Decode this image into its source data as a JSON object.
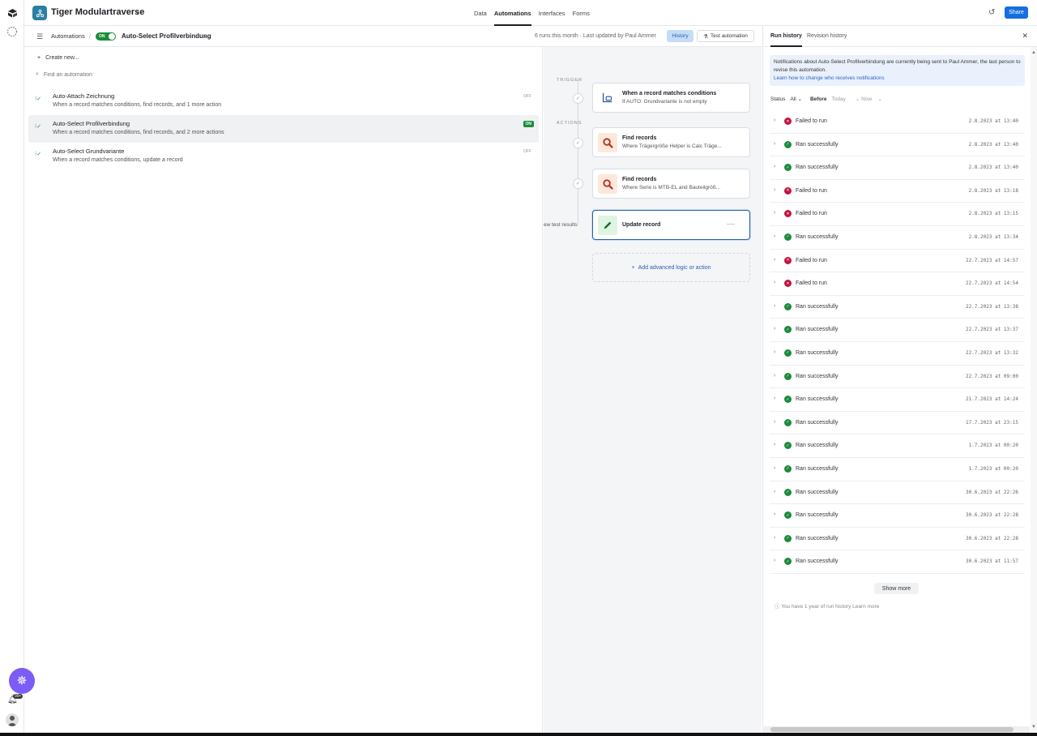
{
  "base": {
    "name": "Tiger Modulartraverse"
  },
  "nav": {
    "items": [
      "Data",
      "Automations",
      "Interfaces",
      "Forms"
    ],
    "active": 1
  },
  "share_label": "Share",
  "subheader": {
    "section": "Automations",
    "separator": "/",
    "toggle_label": "ON",
    "automation_name": "Auto-Select Profilverbindung",
    "meta": "6 runs this month · Last updated by Paul Ammer",
    "history_label": "History",
    "test_label": "Test automation"
  },
  "list": {
    "create_label": "Create new...",
    "find_placeholder": "Find an automation",
    "automations": [
      {
        "title": "Auto-Attach Zeichnung",
        "desc": "When a record matches conditions, find records, and 1 more action",
        "status": "OFF"
      },
      {
        "title": "Auto-Select Profilverbindung",
        "desc": "When a record matches conditions, find records, and 2 more actions",
        "status": "ON"
      },
      {
        "title": "Auto-Select Grundvariante",
        "desc": "When a record matches conditions, update a record",
        "status": "OFF"
      }
    ]
  },
  "canvas": {
    "trigger_label": "TRIGGER",
    "actions_label": "ACTIONS",
    "view_test_results": "ew test results",
    "steps": [
      {
        "title": "When a record matches conditions",
        "desc": "If AUTO: Grundvariante is not empty",
        "icon": "trigger-condition-icon"
      },
      {
        "title": "Find records",
        "desc": "Where Trägergröße Helper is Calc Träge...",
        "icon": "search-icon"
      },
      {
        "title": "Find records",
        "desc": "Where Serie is MTB-EL and Bauteilgröß...",
        "icon": "search-icon"
      },
      {
        "title": "Update record",
        "desc": "",
        "icon": "pencil-icon"
      }
    ],
    "add_logic_label": "Add advanced logic or action"
  },
  "right": {
    "tabs": [
      "Run history",
      "Revision history"
    ],
    "notice_text": "Notifications about Auto-Select Profilverbindung are currently being sent to Paul Ammer, the last person to revise this automation.",
    "notice_link": "Learn how to change who receives notifications",
    "filters": {
      "status_label": "Status",
      "status_value": "All",
      "before_label": "Before",
      "before_value": "Today",
      "now_value": "Now"
    },
    "runs": [
      {
        "status": "fail",
        "label": "Failed to run",
        "time": "2.8.2023 at 13:40"
      },
      {
        "status": "ok",
        "label": "Ran successfully",
        "time": "2.8.2023 at 13:40"
      },
      {
        "status": "ok",
        "label": "Ran successfully",
        "time": "2.8.2023 at 13:40"
      },
      {
        "status": "fail",
        "label": "Failed to run",
        "time": "2.8.2023 at 13:18"
      },
      {
        "status": "fail",
        "label": "Failed to run",
        "time": "2.8.2023 at 13:15"
      },
      {
        "status": "ok",
        "label": "Ran successfully",
        "time": "2.8.2023 at 13:34"
      },
      {
        "status": "fail",
        "label": "Failed to run",
        "time": "22.7.2023 at 14:57"
      },
      {
        "status": "fail",
        "label": "Failed to run",
        "time": "22.7.2023 at 14:54"
      },
      {
        "status": "ok",
        "label": "Ran successfully",
        "time": "22.7.2023 at 13:38"
      },
      {
        "status": "ok",
        "label": "Ran successfully",
        "time": "22.7.2023 at 13:37"
      },
      {
        "status": "ok",
        "label": "Ran successfully",
        "time": "22.7.2023 at 13:32"
      },
      {
        "status": "ok",
        "label": "Ran successfully",
        "time": "22.7.2023 at 09:00"
      },
      {
        "status": "ok",
        "label": "Ran successfully",
        "time": "21.7.2023 at 14:24"
      },
      {
        "status": "ok",
        "label": "Ran successfully",
        "time": "17.7.2023 at 23:15"
      },
      {
        "status": "ok",
        "label": "Ran successfully",
        "time": "1.7.2023 at 00:20"
      },
      {
        "status": "ok",
        "label": "Ran successfully",
        "time": "1.7.2023 at 00:20"
      },
      {
        "status": "ok",
        "label": "Ran successfully",
        "time": "30.6.2023 at 22:26"
      },
      {
        "status": "ok",
        "label": "Ran successfully",
        "time": "30.6.2023 at 22:28"
      },
      {
        "status": "ok",
        "label": "Ran successfully",
        "time": "30.6.2023 at 22:28"
      },
      {
        "status": "ok",
        "label": "Ran successfully",
        "time": "30.6.2023 at 11:57"
      }
    ],
    "show_more": "Show more",
    "history_note": "You have 1 year of run history Learn more"
  },
  "colors": {
    "accent": "#166ee1",
    "success": "#1a8c3a",
    "failure": "#c1143f",
    "help": "#7c5cf5"
  },
  "icons": [
    "airtable-logo-icon",
    "loading-icon",
    "help-icon",
    "bell-icon",
    "avatar",
    "history-icon",
    "menu-icon",
    "plus-icon",
    "search-icon",
    "close-icon",
    "chevron-right-icon",
    "chevron-down-icon",
    "check-icon",
    "pencil-icon"
  ]
}
